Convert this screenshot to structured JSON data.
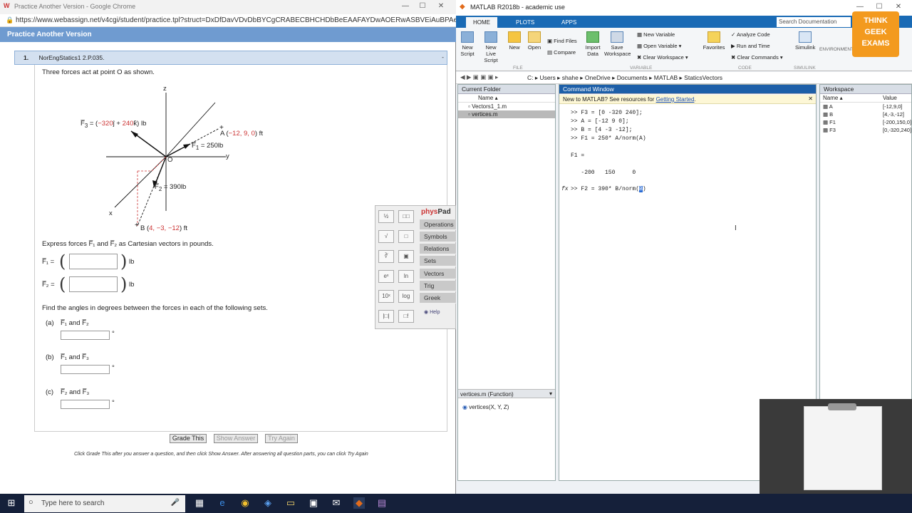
{
  "chrome": {
    "title": "Practice Another Version - Google Chrome",
    "url": "https://www.webassign.net/v4cgi/student/practice.tpl?struct=DxDfDavVDvDbBYCgCRABECBHCHDbBeEAAFAYDwAOERwASBVEiAuBPAeBAAuDX...",
    "page_bar": "Practice Another Version"
  },
  "question": {
    "number": "1.",
    "id": "NorEngStatics1 2.P.035.",
    "collapse": "-",
    "intro": "Three forces act at point O as shown.",
    "figure": {
      "z": "z",
      "y": "y",
      "x": "x",
      "o": "O",
      "f3_label": "F̅₃ = (−320ĵ + 240k̂) lb",
      "f3_pre": "F̅",
      "f3_sub": "3",
      "f3_eq": " = (",
      "f3_v1": "−320",
      "f3_j": "ĵ + ",
      "f3_v2": "240",
      "f3_k": "k̂) lb",
      "f1_pre": "F̅",
      "f1_sub": "1",
      "f1_val": " = 250lb",
      "f2_pre": "F̅",
      "f2_sub": "2",
      "f2_val": " = 390lb",
      "a_pre": "A (",
      "a_v": "−12, 9, 0",
      "a_post": ") ft",
      "b_pre": "B (",
      "b_v": "4, −3, −12",
      "b_post": ") ft"
    },
    "express": "Express forces F̅₁ and F̅₂ as Cartesian vectors in pounds.",
    "f1_input_label": "F̅₁ =",
    "f2_input_label": "F̅₂ =",
    "unit_lb": "lb",
    "angles_prompt": "Find the angles in degrees between the forces in each of the following sets.",
    "parts": [
      {
        "label": "(a)",
        "text": "F̅₁ and F̅₂"
      },
      {
        "label": "(b)",
        "text": "F̅₁ and F̅₃"
      },
      {
        "label": "(c)",
        "text": "F̅₂ and F̅₃"
      }
    ],
    "deg": "°",
    "buttons": {
      "grade": "Grade This",
      "show": "Show Answer",
      "retry": "Try Again"
    },
    "footer": "Click Grade This after you answer a question, and then click Show Answer. After answering all question parts, you can click Try Again"
  },
  "physpad": {
    "title_a": "phys",
    "title_b": "Pad",
    "tabs": [
      "Operations",
      "Symbols",
      "Relations",
      "Sets",
      "Vectors",
      "Trig",
      "Greek"
    ],
    "help": "Help",
    "cells": [
      "½",
      "□□",
      "√",
      "□",
      "∛",
      "▣",
      "eˣ",
      "ln",
      "10ˣ",
      "log",
      "|□|",
      "□!"
    ]
  },
  "matlab": {
    "title": "MATLAB R2018b - academic use",
    "tabs": [
      "HOME",
      "PLOTS",
      "APPS"
    ],
    "search_placeholder": "Search Documentation",
    "ribbon": {
      "new_script": "New Script",
      "new_live": "New Live Script",
      "new": "New",
      "open": "Open",
      "find_files": "Find Files",
      "compare": "Compare",
      "import": "Import Data",
      "save_ws": "Save Workspace",
      "new_var": "New Variable",
      "open_var": "Open Variable",
      "clear_ws": "Clear Workspace",
      "favorites": "Favorites",
      "analyze": "Analyze Code",
      "run_time": "Run and Time",
      "clear_cmds": "Clear Commands",
      "simulink": "Simulink",
      "environment": "ENVIRONMENT",
      "sec_file": "FILE",
      "sec_variable": "VARIABLE",
      "sec_code": "CODE",
      "sec_simulink": "SIMULINK"
    },
    "path": [
      "C:",
      "Users",
      "shahe",
      "OneDrive",
      "Documents",
      "MATLAB",
      "StaticsVectors"
    ],
    "current_folder": {
      "title": "Current Folder",
      "name_col": "Name ▴",
      "files": [
        "Vectors1_1.m",
        "vertices.m"
      ],
      "details_title": "vertices.m  (Function)",
      "details_item": "vertices(X, Y, Z)"
    },
    "command_window": {
      "title": "Command Window",
      "notice": "New to MATLAB? See resources for ",
      "notice_link": "Getting Started",
      "notice_end": ".",
      "lines": [
        ">> F3 = [0 -320 240];",
        ">> A = [-12 9 0];",
        ">> B = [4 -3 -12];",
        ">> F1 = 250* A/norm(A)",
        "",
        "F1 =",
        "",
        "   -200   150     0",
        ""
      ],
      "prompt": "fx",
      "current": ">> F2 = 390* B/norm(",
      "current_sel": "B",
      "current_end": ")"
    },
    "workspace": {
      "title": "Workspace",
      "col_name": "Name ▴",
      "col_value": "Value",
      "vars": [
        {
          "name": "A",
          "value": "[-12,9,0]"
        },
        {
          "name": "B",
          "value": "[4,-3,-12]"
        },
        {
          "name": "F1",
          "value": "[-200,150,0]"
        },
        {
          "name": "F3",
          "value": "[0,-320,240]"
        }
      ]
    }
  },
  "badge": {
    "line1": "THINK",
    "line2": "GEEK",
    "line3": "EXAMS"
  },
  "taskbar": {
    "search": "Type here to search"
  }
}
